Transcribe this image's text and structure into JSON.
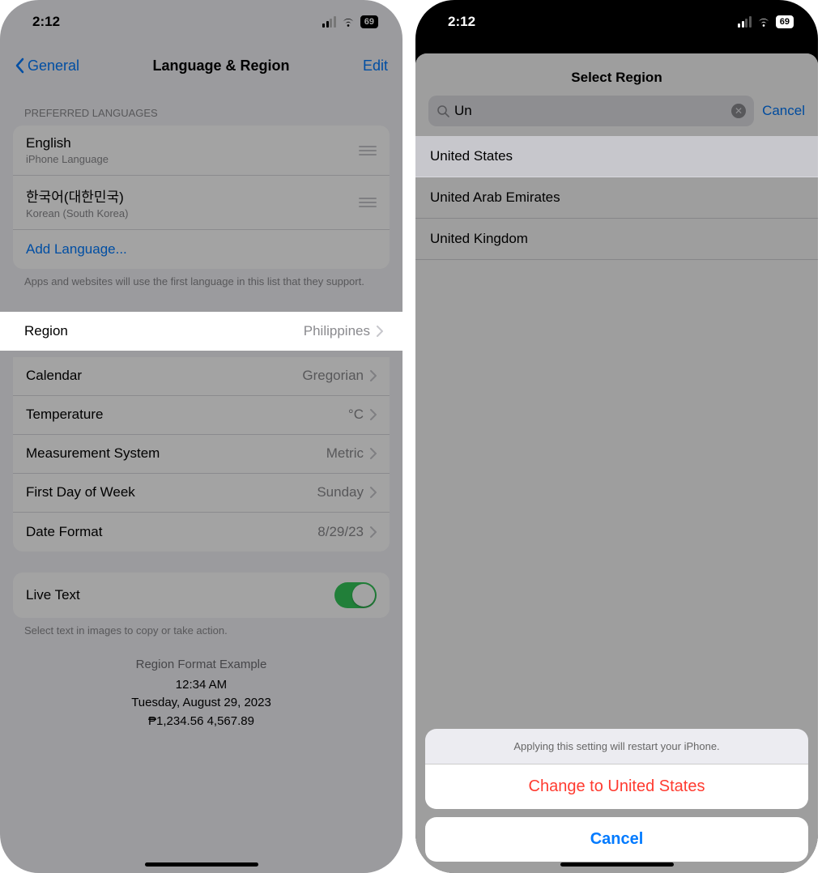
{
  "left": {
    "status": {
      "time": "2:12",
      "battery": "69"
    },
    "nav": {
      "back": "General",
      "title": "Language & Region",
      "edit": "Edit"
    },
    "preferred_header": "PREFERRED LANGUAGES",
    "languages": [
      {
        "name": "English",
        "detail": "iPhone Language"
      },
      {
        "name": "한국어(대한민국)",
        "detail": "Korean (South Korea)"
      }
    ],
    "add_language": "Add Language...",
    "lang_footer": "Apps and websites will use the first language in this list that they support.",
    "region_rows": {
      "region": {
        "label": "Region",
        "value": "Philippines"
      },
      "calendar": {
        "label": "Calendar",
        "value": "Gregorian"
      },
      "temperature": {
        "label": "Temperature",
        "value": "°C"
      },
      "measurement": {
        "label": "Measurement System",
        "value": "Metric"
      },
      "first_day": {
        "label": "First Day of Week",
        "value": "Sunday"
      },
      "date_format": {
        "label": "Date Format",
        "value": "8/29/23"
      }
    },
    "live_text": {
      "label": "Live Text",
      "footer": "Select text in images to copy or take action."
    },
    "example": {
      "title": "Region Format Example",
      "time": "12:34 AM",
      "date": "Tuesday, August 29, 2023",
      "numbers": "₱1,234.56   4,567.89"
    }
  },
  "right": {
    "status": {
      "time": "2:12",
      "battery": "69"
    },
    "sheet_title": "Select Region",
    "search": {
      "query": "Un",
      "cancel": "Cancel"
    },
    "results": [
      "United States",
      "United Arab Emirates",
      "United Kingdom"
    ],
    "action": {
      "message": "Applying this setting will restart your iPhone.",
      "confirm": "Change to United States",
      "cancel": "Cancel"
    }
  }
}
